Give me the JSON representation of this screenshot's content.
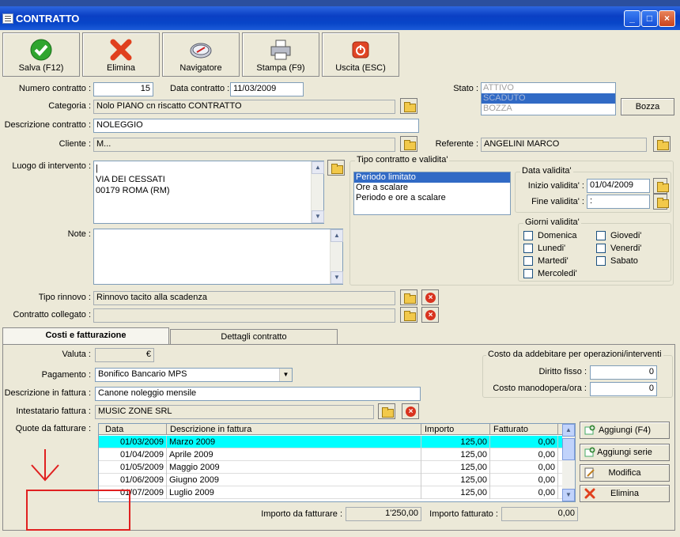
{
  "window": {
    "title": "CONTRATTO"
  },
  "toolbar": {
    "save": "Salva (F12)",
    "delete": "Elimina",
    "navigator": "Navigatore",
    "print": "Stampa (F9)",
    "exit": "Uscita (ESC)"
  },
  "header": {
    "numero_label": "Numero contratto :",
    "numero_value": "15",
    "data_label": "Data contratto :",
    "data_value": "11/03/2009",
    "stato_label": "Stato :",
    "stato_options": [
      "ATTIVO",
      "SCADUTO",
      "BOZZA"
    ],
    "stato_selected": "SCADUTO",
    "bozza_button": "Bozza",
    "categoria_label": "Categoria :",
    "categoria_value": "Nolo PIANO cn riscatto CONTRATTO",
    "descrizione_label": "Descrizione contratto :",
    "descrizione_value": "NOLEGGIO",
    "cliente_label": "Cliente :",
    "cliente_value": "M...",
    "referente_label": "Referente :",
    "referente_value": "ANGELINI MARCO",
    "luogo_label": "Luogo di intervento :",
    "luogo_lines": [
      "|",
      "VIA DEI CESSATI",
      "00179 ROMA (RM)"
    ],
    "note_label": "Note :",
    "rinnovo_label": "Tipo rinnovo :",
    "rinnovo_value": "Rinnovo tacito alla scadenza",
    "collegato_label": "Contratto collegato :",
    "collegato_value": ""
  },
  "tipo_contratto": {
    "title": "Tipo contratto e validita'",
    "options": [
      "Periodo limitato",
      "Ore a scalare",
      "Periodo e ore a scalare"
    ],
    "selected": "Periodo limitato",
    "data_validita_title": "Data validita'",
    "inizio_label": "Inizio validita' :",
    "inizio_value": "01/04/2009",
    "fine_label": "Fine validita' :",
    "fine_value": ":",
    "giorni_title": "Giorni validita'",
    "giorni": [
      "Domenica",
      "Lunedi'",
      "Martedi'",
      "Mercoledi'",
      "Giovedi'",
      "Venerdi'",
      "Sabato"
    ]
  },
  "tabs": {
    "costi": "Costi e fatturazione",
    "dettagli": "Dettagli contratto"
  },
  "costi": {
    "valuta_label": "Valuta :",
    "valuta_value": "€",
    "pagamento_label": "Pagamento :",
    "pagamento_value": "Bonifico Bancario MPS",
    "descr_fattura_label": "Descrizione in fattura :",
    "descr_fattura_value": "Canone noleggio mensile",
    "intestatario_label": "Intestatario fattura :",
    "intestatario_value": "MUSIC ZONE SRL",
    "quote_label": "Quote da fatturare :",
    "addebito_title": "Costo da addebitare per operazioni/interventi",
    "diritto_label": "Diritto fisso :",
    "diritto_value": "0",
    "manodopera_label": "Costo manodopera/ora :",
    "manodopera_value": "0",
    "importo_da_label": "Importo da fatturare :",
    "importo_da_value": "1'250,00",
    "importo_fatt_label": "Importo fatturato :",
    "importo_fatt_value": "0,00"
  },
  "grid": {
    "columns": [
      "Data",
      "Descrizione in fattura",
      "Importo",
      "Fatturato"
    ],
    "rows": [
      [
        "01/03/2009",
        "Marzo 2009",
        "125,00",
        "0,00"
      ],
      [
        "01/04/2009",
        "Aprile 2009",
        "125,00",
        "0,00"
      ],
      [
        "01/05/2009",
        "Maggio 2009",
        "125,00",
        "0,00"
      ],
      [
        "01/06/2009",
        "Giugno 2009",
        "125,00",
        "0,00"
      ],
      [
        "01/07/2009",
        "Luglio 2009",
        "125,00",
        "0,00"
      ]
    ]
  },
  "side_buttons": {
    "aggiungi": "Aggiungi (F4)",
    "aggiungi_serie": "Aggiungi serie",
    "modifica": "Modifica",
    "elimina": "Elimina"
  }
}
